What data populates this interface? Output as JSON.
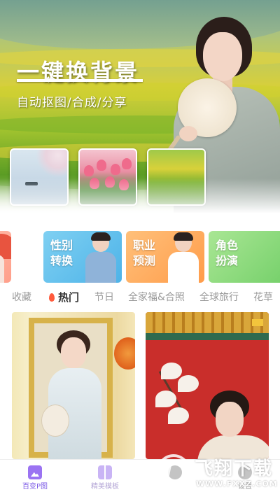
{
  "hero": {
    "title": "一键换背景",
    "subtitle": "自动抠图/合成/分享"
  },
  "categories": [
    {
      "label": ""
    },
    {
      "label": "性别转换",
      "line1": "性别",
      "line2": "转换"
    },
    {
      "label": "职业预测",
      "line1": "职业",
      "line2": "预测"
    },
    {
      "label": "角色扮演",
      "line1": "角色",
      "line2": "扮演"
    }
  ],
  "tabs": [
    {
      "label": "收藏",
      "active": false
    },
    {
      "label": "热门",
      "active": true,
      "icon": "fire-icon"
    },
    {
      "label": "节日",
      "active": false
    },
    {
      "label": "全家福&合照",
      "active": false
    },
    {
      "label": "全球旅行",
      "active": false
    },
    {
      "label": "花草",
      "active": false
    }
  ],
  "bottom_nav": [
    {
      "label": "百变P图",
      "icon": "image-edit-icon",
      "active": true
    },
    {
      "label": "精美模板",
      "icon": "template-icon",
      "active": false
    },
    {
      "label": "",
      "icon": "nav-icon-3",
      "active": false
    },
    {
      "label": "设置",
      "icon": "settings-icon",
      "active": false
    }
  ],
  "watermark": {
    "text": "飞翔下载",
    "url": "WWW.FXXZ.COM"
  },
  "colors": {
    "accent": "#7b5ae6",
    "tab_active": "#333333",
    "tab_inactive": "#9a9a9a",
    "fire": "#ff5a3c"
  }
}
